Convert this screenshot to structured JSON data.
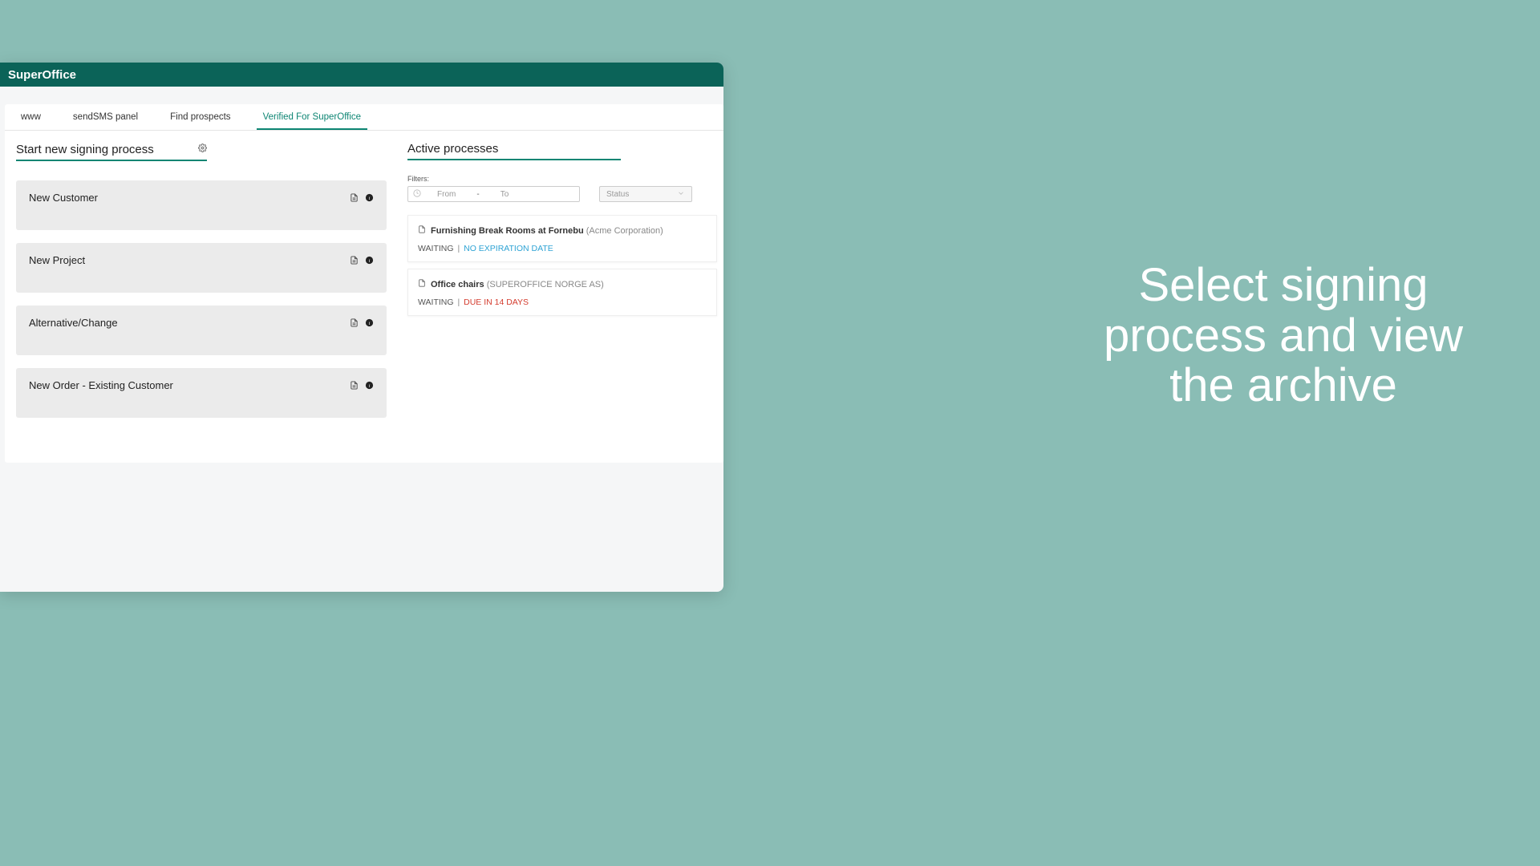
{
  "brand": "SuperOffice",
  "tabs": [
    {
      "label": "www",
      "active": false
    },
    {
      "label": "sendSMS panel",
      "active": false
    },
    {
      "label": "Find prospects",
      "active": false
    },
    {
      "label": "Verified For SuperOffice",
      "active": true
    }
  ],
  "left": {
    "title": "Start new signing process",
    "items": [
      {
        "label": "New Customer"
      },
      {
        "label": "New Project"
      },
      {
        "label": "Alternative/Change"
      },
      {
        "label": "New Order - Existing Customer"
      }
    ]
  },
  "right": {
    "title": "Active processes",
    "filters": {
      "label": "Filters:",
      "from": "From",
      "to": "To",
      "dash": "-",
      "status": "Status"
    },
    "processes": [
      {
        "name": "Furnishing Break Rooms at Fornebu",
        "org": "(Acme Corporation)",
        "status": "WAITING",
        "due": "NO EXPIRATION DATE",
        "dueClass": "blue"
      },
      {
        "name": "Office chairs",
        "org": "(SUPEROFFICE NORGE AS)",
        "status": "WAITING",
        "due": "DUE IN 14 DAYS",
        "dueClass": "red"
      }
    ]
  },
  "promo": "Select signing process and view the archive"
}
